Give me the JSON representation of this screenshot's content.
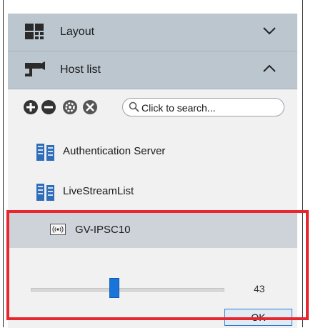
{
  "sections": {
    "layout": {
      "label": "Layout",
      "icon": "layout-grid-icon",
      "chevron": "chevron-down-icon"
    },
    "host_list": {
      "label": "Host list",
      "icon": "camera-icon",
      "chevron": "chevron-up-icon"
    }
  },
  "toolbar": {
    "buttons": [
      {
        "icon": "add-icon"
      },
      {
        "icon": "remove-icon"
      },
      {
        "icon": "settings-icon"
      },
      {
        "icon": "tools-icon"
      }
    ],
    "search": {
      "placeholder": "Click to search..."
    }
  },
  "hosts": [
    {
      "label": "Authentication Server",
      "icon": "server-icon"
    },
    {
      "label": "LiveStreamList",
      "icon": "server-icon"
    }
  ],
  "device": {
    "label": "GV-IPSC10",
    "icon": "wireless-device-icon"
  },
  "slider": {
    "value": "43",
    "fraction": 0.43
  },
  "buttons": {
    "ok_label": "OK"
  },
  "colors": {
    "highlight": "#e8262e",
    "accent": "#1a73d9",
    "header": "#bcc6cf"
  }
}
